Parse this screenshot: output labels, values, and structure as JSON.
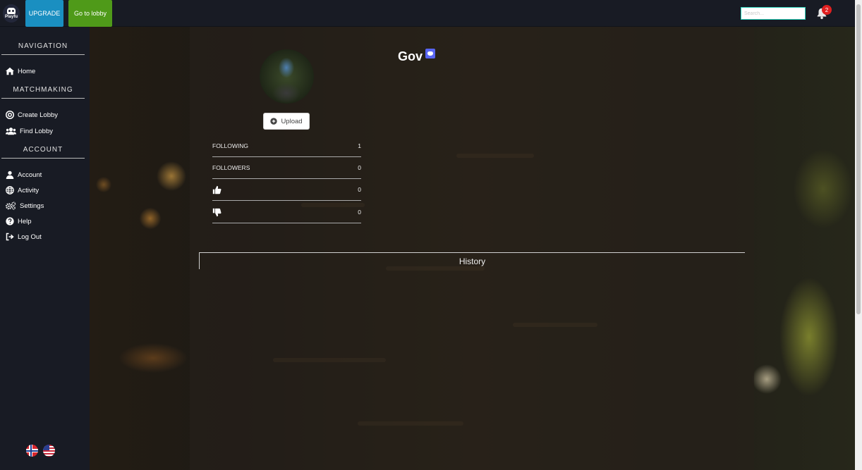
{
  "topbar": {
    "logo_text": "Playfu",
    "upgrade_label": "UPGRADE",
    "lobby_label": "Go to lobby",
    "search_placeholder": "Search...",
    "notification_count": "2"
  },
  "sidebar": {
    "sections": [
      {
        "title": "NAVIGATION",
        "items": [
          {
            "label": "Home",
            "icon": "home-icon"
          }
        ]
      },
      {
        "title": "MATCHMAKING",
        "items": [
          {
            "label": "Create Lobby",
            "icon": "target-icon"
          },
          {
            "label": "Find Lobby",
            "icon": "users-icon"
          }
        ]
      },
      {
        "title": "ACCOUNT",
        "items": [
          {
            "label": "Account",
            "icon": "user-icon"
          },
          {
            "label": "Activity",
            "icon": "globe-icon"
          },
          {
            "label": "Settings",
            "icon": "cogs-icon"
          },
          {
            "label": "Help",
            "icon": "question-icon"
          },
          {
            "label": "Log Out",
            "icon": "sign-out-icon"
          }
        ]
      }
    ],
    "languages": [
      "norway-flag-icon",
      "usa-flag-icon"
    ]
  },
  "profile": {
    "username": "Gov",
    "upload_label": "Upload",
    "stats": [
      {
        "label": "FOLLOWING",
        "value": "1"
      },
      {
        "label": "FOLLOWERS",
        "value": "0"
      },
      {
        "icon": "thumbs-up-icon",
        "value": "0"
      },
      {
        "icon": "thumbs-down-icon",
        "value": "0"
      }
    ],
    "history_label": "History"
  },
  "colors": {
    "upgrade": "#1a8fc1",
    "lobby": "#4f9a19",
    "sidebar_bg": "#181b24",
    "badge": "#e02020",
    "discord": "#5865f2"
  }
}
